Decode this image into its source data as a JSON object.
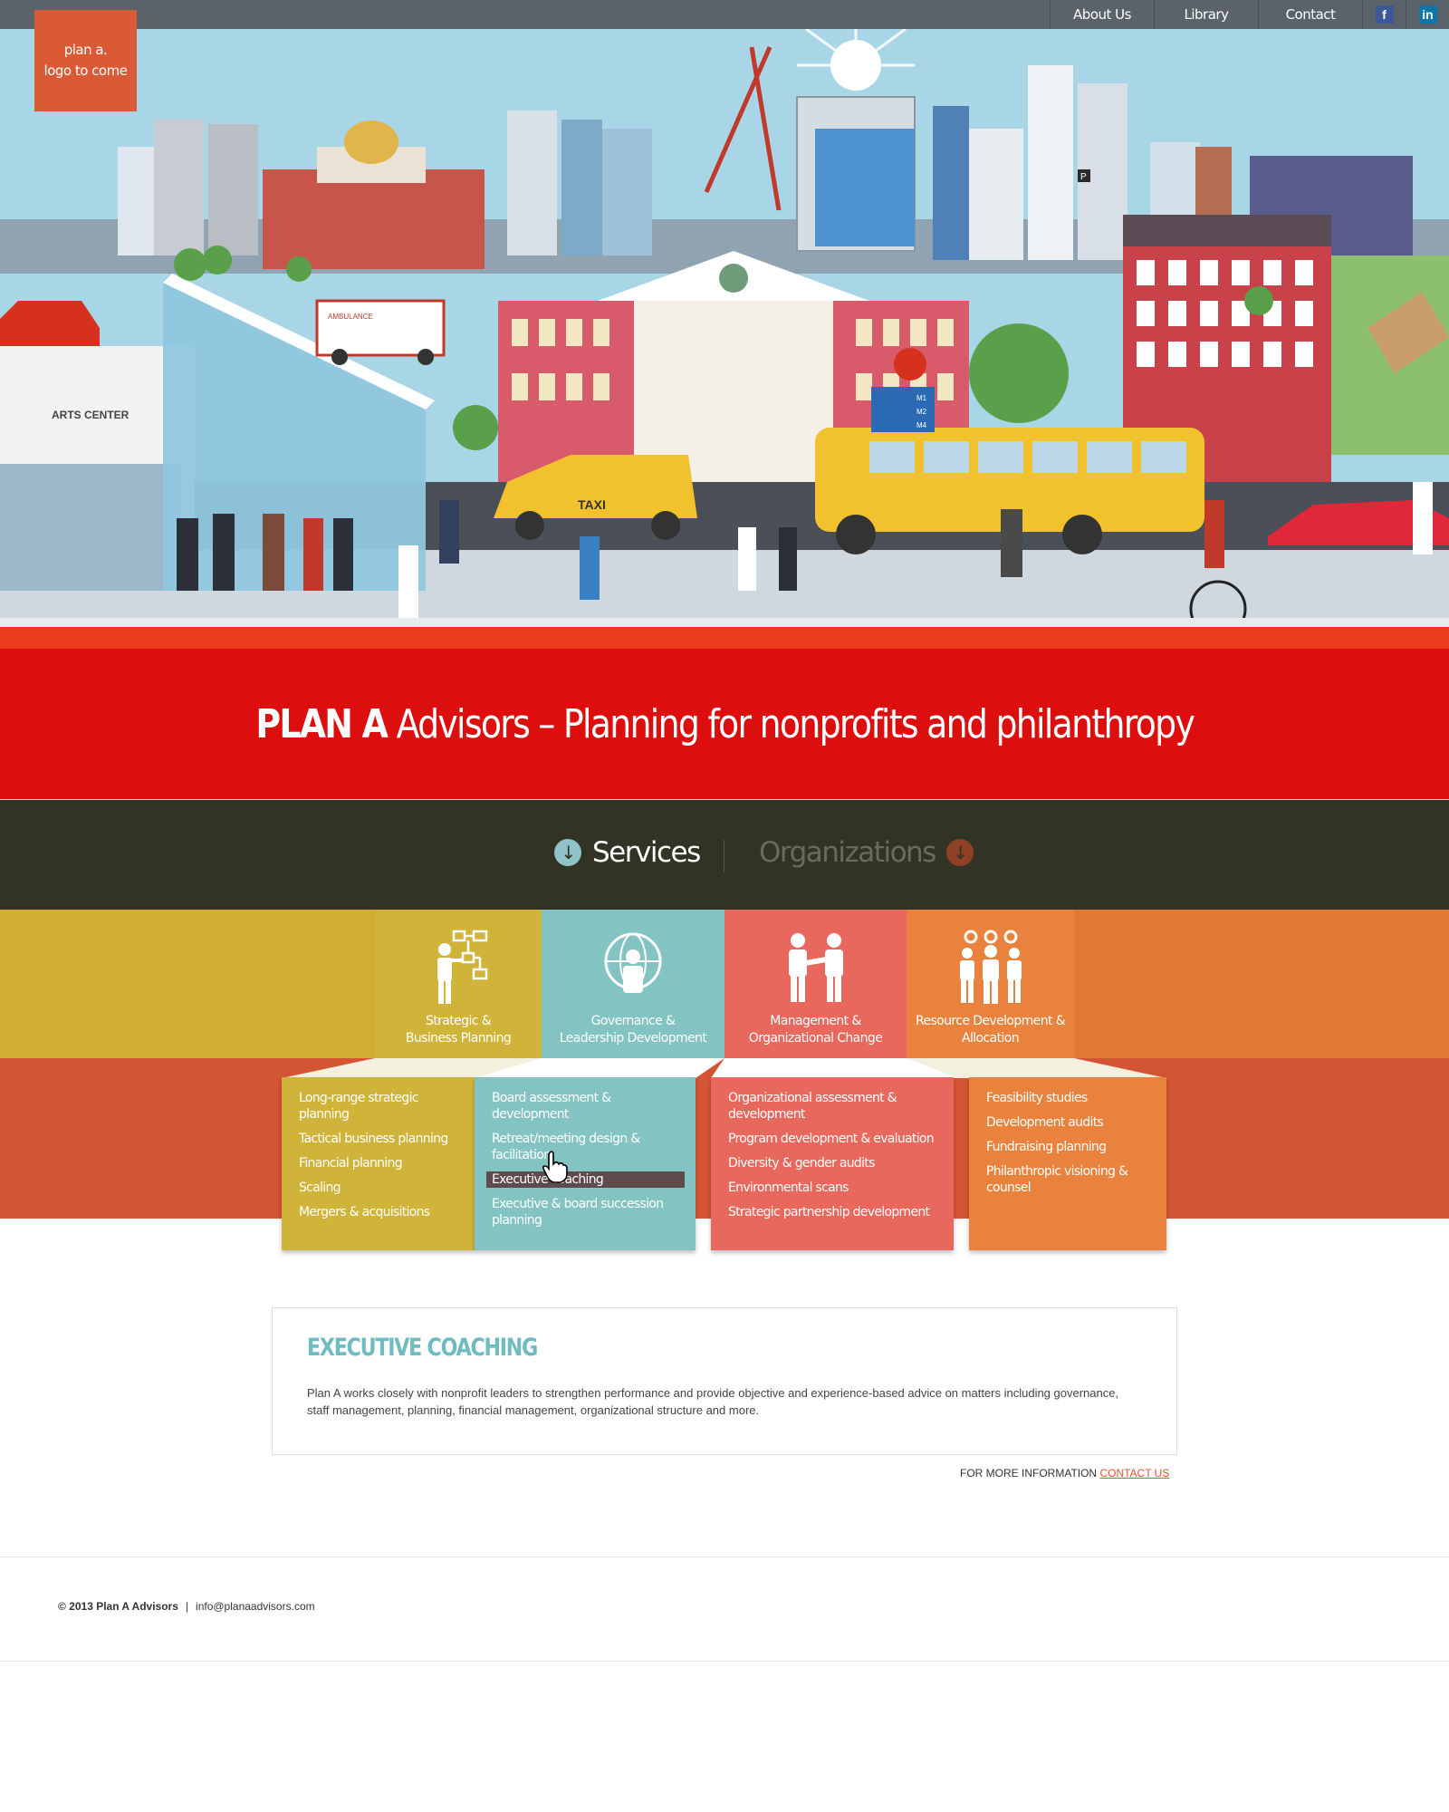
{
  "nav": {
    "links": [
      "About Us",
      "Library",
      "Contact"
    ],
    "social": [
      {
        "icon": "facebook-icon",
        "glyph": "f"
      },
      {
        "icon": "linkedin-icon",
        "glyph": "in"
      }
    ]
  },
  "logo": {
    "line1": "plan a.",
    "line2": "logo to come"
  },
  "hero": {
    "sign_arts": "ARTS CENTER",
    "taxi": "TAXI",
    "ambulance": "AMBULANCE",
    "bus_routes": [
      "M1",
      "M2",
      "M4"
    ],
    "parking": "P"
  },
  "banner": {
    "brand": "PLAN A",
    "tagline": " Advisors – Planning for nonprofits and philanthropy"
  },
  "tabs": {
    "services": {
      "label": "Services",
      "icon": "arrow-down-icon"
    },
    "organizations": {
      "label": "Organizations",
      "icon": "arrow-down-icon"
    }
  },
  "colors": {
    "strategic": "#d0b43a",
    "governance": "#83c3c2",
    "management": "#e8685d",
    "resource": "#e9823d"
  },
  "categories": [
    {
      "line1": "Strategic &",
      "line2": "Business Planning",
      "icon": "flowchart-person-icon"
    },
    {
      "line1": "Governance &",
      "line2": "Leadership Development",
      "icon": "globe-person-icon"
    },
    {
      "line1": "Management &",
      "line2": "Organizational Change",
      "icon": "handshake-icon"
    },
    {
      "line1": "Resource Development &",
      "line2": "Allocation",
      "icon": "gears-people-icon"
    }
  ],
  "panels": [
    {
      "items": [
        "Long-range strategic planning",
        "Tactical business planning",
        "Financial planning",
        "Scaling",
        "Mergers & acquisitions"
      ]
    },
    {
      "items": [
        "Board assessment & development",
        "Retreat/meeting design & facilitation",
        "Executive coaching",
        "Executive & board succession planning"
      ],
      "active": 2
    },
    {
      "items": [
        "Organizational assessment & development",
        "Program development & evaluation",
        "Diversity & gender audits",
        "Environmental scans",
        "Strategic partnership development"
      ]
    },
    {
      "items": [
        "Feasibility studies",
        "Development audits",
        "Fundraising planning",
        "Philanthropic visioning & counsel"
      ]
    }
  ],
  "detail": {
    "title": "EXECUTIVE COACHING",
    "body": "Plan A works closely with nonprofit leaders to strengthen performance and provide objective and experience-based advice on matters including governance, staff management, planning, financial management, organizational structure and more."
  },
  "more_info": {
    "text": "FOR MORE INFORMATION ",
    "link": "CONTACT US"
  },
  "footer": {
    "copyright": "© 2013 Plan A Advisors",
    "separator": "|",
    "email": "info@planaadvisors.com"
  }
}
